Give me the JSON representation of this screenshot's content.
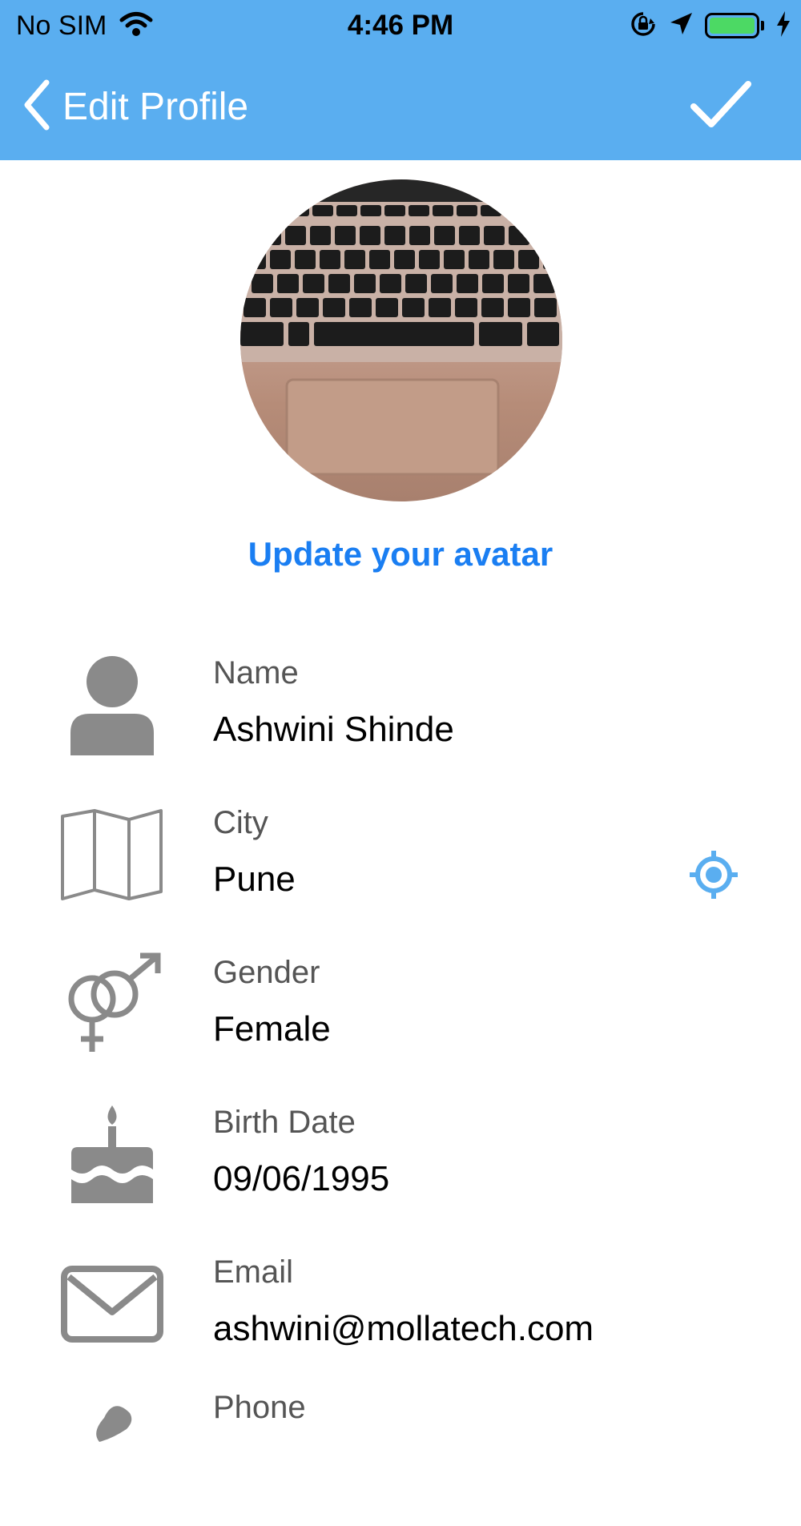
{
  "status_bar": {
    "carrier": "No SIM",
    "time": "4:46 PM",
    "battery_level": 1.0,
    "battery_color": "#4cd964",
    "icons": [
      "wifi-icon",
      "orientation-lock-icon",
      "location-arrow-icon",
      "battery-icon",
      "charging-bolt-icon"
    ]
  },
  "nav": {
    "title": "Edit Profile",
    "back_icon": "chevron-left-icon",
    "done_icon": "checkmark-icon",
    "background": "#5aaef0"
  },
  "avatar": {
    "action_label": "Update your avatar",
    "accent": "#1a7ef2"
  },
  "fields": [
    {
      "id": "name",
      "label": "Name",
      "value": "Ashwini Shinde",
      "icon": "person-icon"
    },
    {
      "id": "city",
      "label": "City",
      "value": "Pune",
      "icon": "map-icon",
      "action_icon": "locate-icon"
    },
    {
      "id": "gender",
      "label": "Gender",
      "value": "Female",
      "icon": "gender-icon"
    },
    {
      "id": "birth_date",
      "label": "Birth Date",
      "value": "09/06/1995",
      "icon": "birthday-cake-icon"
    },
    {
      "id": "email",
      "label": "Email",
      "value": "ashwini@mollatech.com",
      "icon": "envelope-icon"
    },
    {
      "id": "phone",
      "label": "Phone",
      "value": "",
      "icon": "phone-icon"
    }
  ]
}
